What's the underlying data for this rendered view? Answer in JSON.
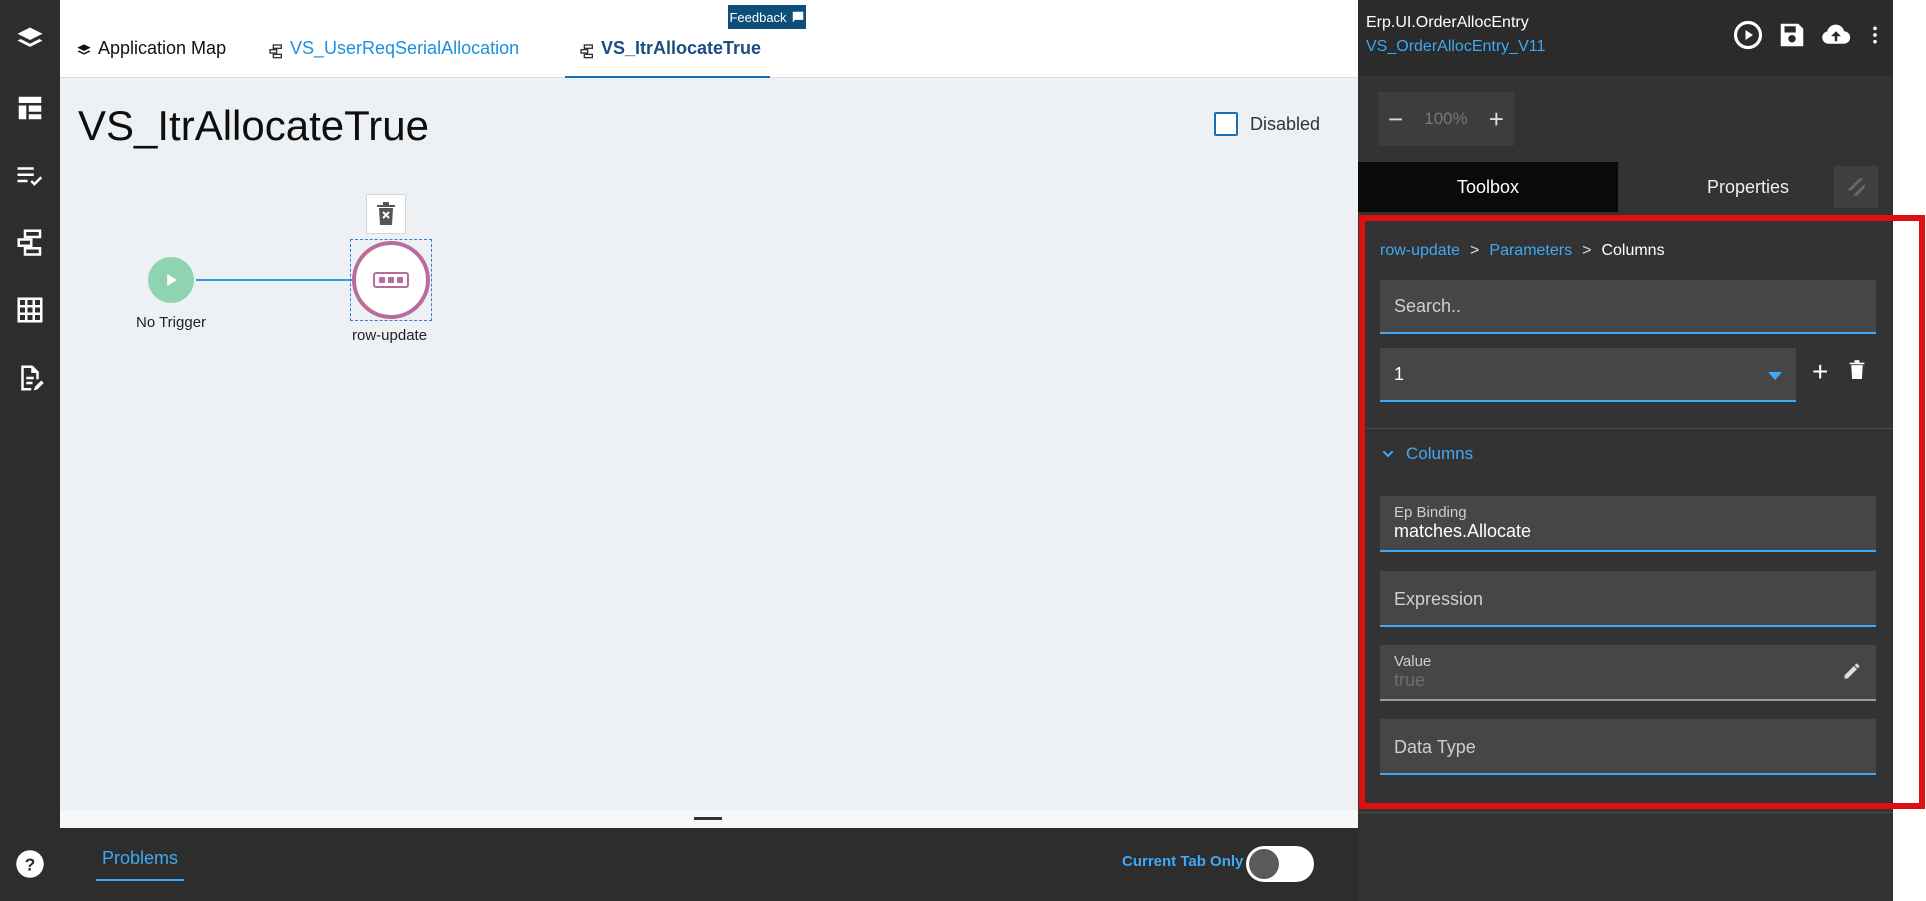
{
  "tabs": {
    "app_map": "Application Map",
    "user_req": "VS_UserReqSerialAllocation",
    "itr_allocate": "VS_ItrAllocateTrue",
    "feedback": "Feedback"
  },
  "canvas": {
    "title": "VS_ItrAllocateTrue",
    "disabled_label": "Disabled",
    "trigger_label": "No Trigger",
    "action_label": "row-update"
  },
  "bottom": {
    "problems_label": "Problems",
    "current_tab_only": "Current Tab Only"
  },
  "right_panel": {
    "app_name": "Erp.UI.OrderAllocEntry",
    "version": "VS_OrderAllocEntry_V11",
    "zoom": "100%",
    "toolbox_tab": "Toolbox",
    "properties_tab": "Properties",
    "breadcrumb": [
      "row-update",
      "Parameters",
      "Columns"
    ],
    "search_placeholder": "Search..",
    "selected_index": "1",
    "section_title": "Columns",
    "ep_binding_label": "Ep Binding",
    "ep_binding_value": "matches.Allocate",
    "expression_label": "Expression",
    "value_label": "Value",
    "value_value": "true",
    "data_type_label": "Data Type"
  },
  "colors": {
    "accent": "#3fa9f5",
    "highlight": "#e01010",
    "trigger_node": "#8ed4b1",
    "action_node": "#b96c9e"
  }
}
